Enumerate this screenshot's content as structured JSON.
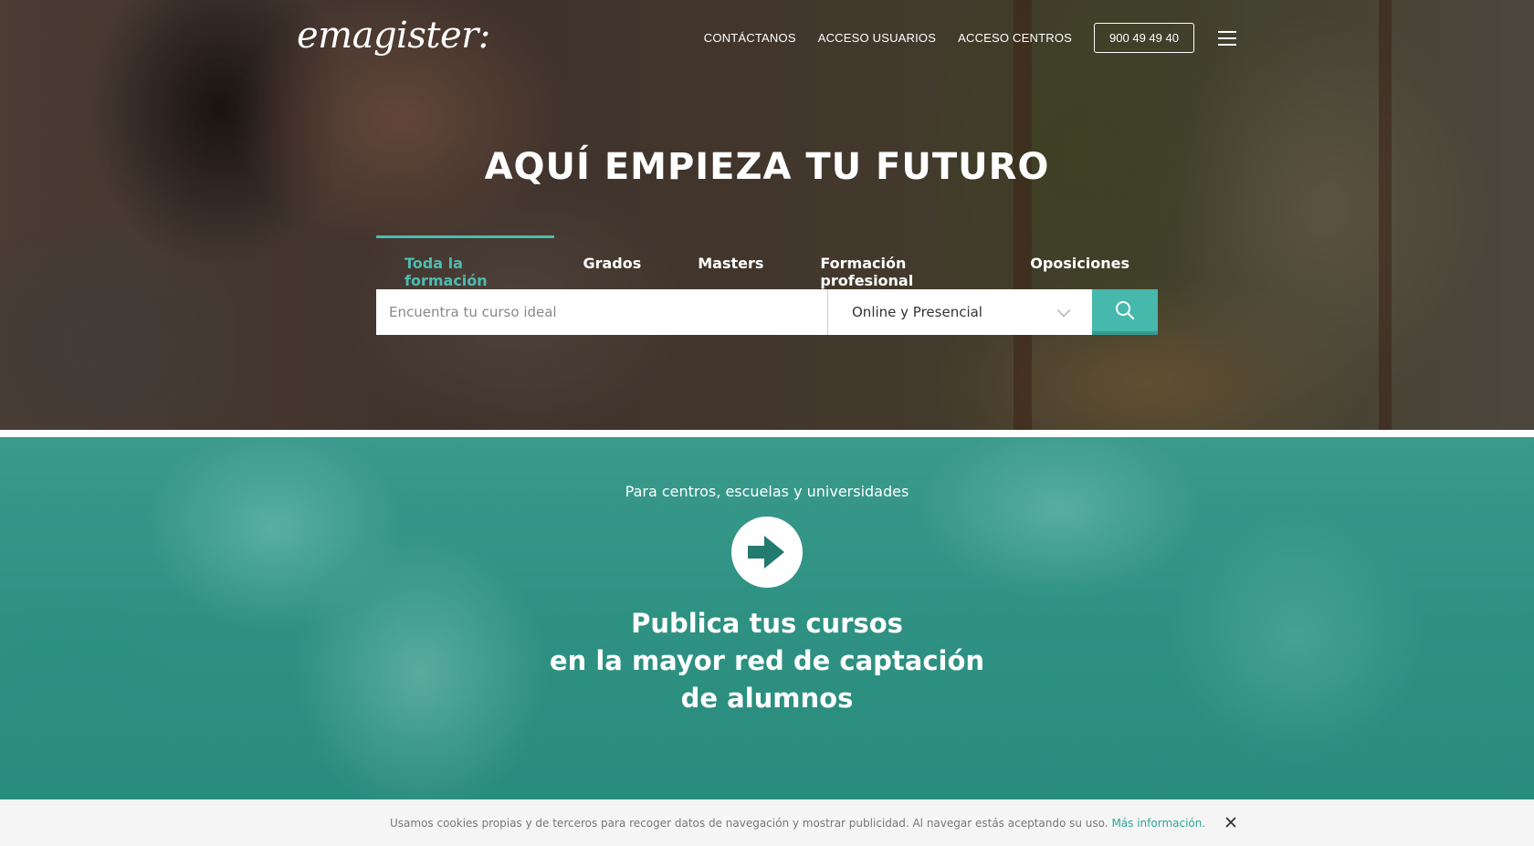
{
  "brand": {
    "logo_text": "emagister:"
  },
  "topnav": {
    "contact": "CONTÁCTANOS",
    "user_access": "ACCESO USUARIOS",
    "center_access": "ACCESO CENTROS",
    "phone": "900 49 49 40"
  },
  "hero": {
    "title": "AQUÍ EMPIEZA TU FUTURO",
    "tabs": [
      {
        "label": "Toda la formación",
        "active": true
      },
      {
        "label": "Grados",
        "active": false
      },
      {
        "label": "Masters",
        "active": false
      },
      {
        "label": "Formación profesional",
        "active": false
      },
      {
        "label": "Oposiciones",
        "active": false
      }
    ],
    "search": {
      "placeholder": "Encuentra tu curso ideal",
      "mode_selected": "Online y Presencial"
    }
  },
  "centers": {
    "subtitle": "Para centros, escuelas y universidades",
    "heading_lines": [
      "Publica tus cursos",
      "en la mayor red de captación",
      "de alumnos"
    ]
  },
  "cookie_bar": {
    "text": "Usamos cookies propias y de terceros para recoger datos de navegación y mostrar publicidad. Al navegar estás aceptando su uso.",
    "link": "Más información."
  },
  "colors": {
    "accent": "#4cbcb0",
    "search_button": "#46b8ac",
    "teal_section": "#2f9283",
    "cookie_link": "#2ba59a"
  },
  "icons": {
    "search": "search-icon",
    "menu": "hamburger-menu-icon",
    "arrow": "arrow-right-icon",
    "close": "close-icon",
    "chevron": "chevron-down-icon"
  }
}
